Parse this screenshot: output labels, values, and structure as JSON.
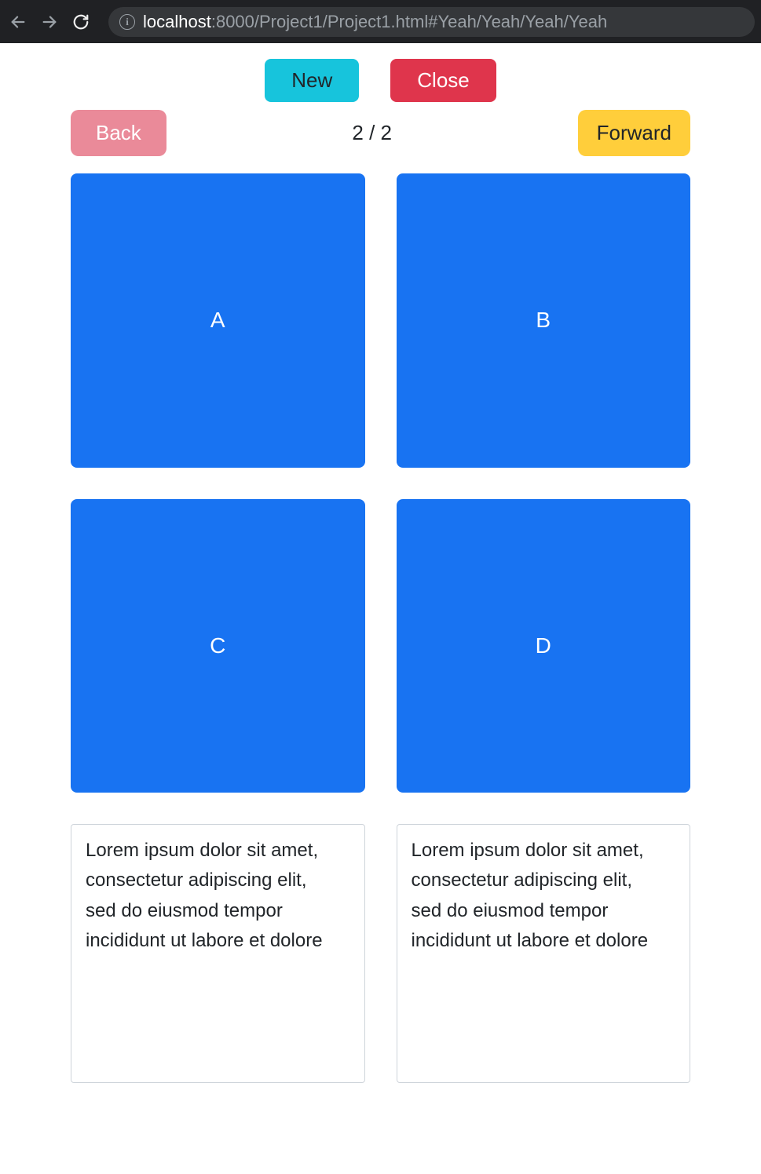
{
  "browser": {
    "url_host": "localhost",
    "url_rest": ":8000/Project1/Project1.html#Yeah/Yeah/Yeah/Yeah"
  },
  "toolbar": {
    "new_label": "New",
    "close_label": "Close"
  },
  "nav": {
    "back_label": "Back",
    "forward_label": "Forward",
    "counter": "2 / 2"
  },
  "tiles": {
    "a": "A",
    "b": "B",
    "c": "C",
    "d": "D"
  },
  "texts": {
    "left": {
      "line1": "Lorem ipsum dolor sit amet,",
      "line2": "consectetur adipiscing elit,",
      "line3": "sed do eiusmod tempor",
      "line4": "incididunt ut labore et dolore"
    },
    "right": {
      "line1": "Lorem ipsum dolor sit amet,",
      "line2": "consectetur adipiscing elit,",
      "line3": "sed do eiusmod tempor",
      "line4": "incididunt ut labore et dolore"
    }
  },
  "colors": {
    "tile": "#1873f2",
    "new_button": "#17c4dc",
    "close_button": "#df354c",
    "back_button": "#ea8a99",
    "forward_button": "#ffce3b"
  }
}
